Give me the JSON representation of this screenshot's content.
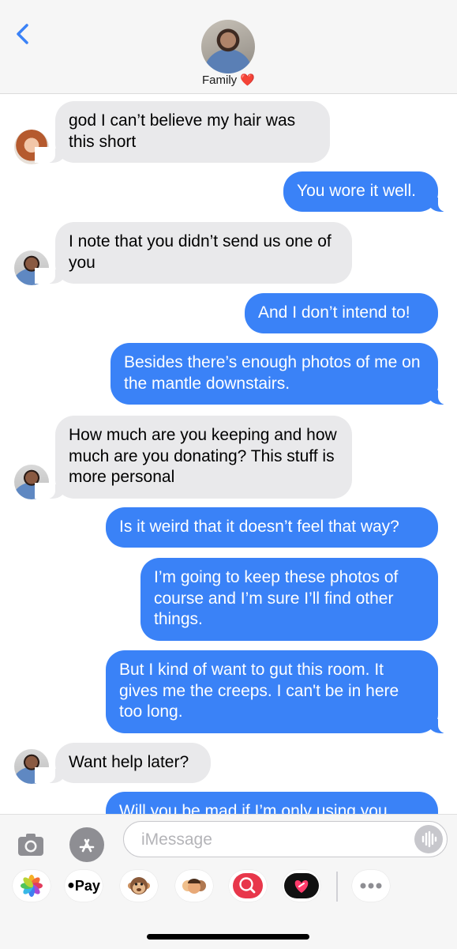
{
  "header": {
    "contact_name": "Family",
    "heart": "❤️"
  },
  "messages": [
    {
      "id": "m1",
      "direction": "in",
      "sender_avatar": "woman",
      "text": "god I can’t believe my hair was this short"
    },
    {
      "id": "m2",
      "direction": "out",
      "text": "You wore it well."
    },
    {
      "id": "m3",
      "direction": "in",
      "sender_avatar": "man",
      "text": "I note that you didn’t send us one of you"
    },
    {
      "id": "m4",
      "direction": "out",
      "text": "And I don’t intend to!"
    },
    {
      "id": "m5",
      "direction": "out",
      "text": "Besides there’s enough photos of me on the mantle downstairs."
    },
    {
      "id": "m6",
      "direction": "in",
      "sender_avatar": "man",
      "text": "How much are you keeping and how much are you donating? This stuff is more personal"
    },
    {
      "id": "m7",
      "direction": "out",
      "text": "Is it weird that it doesn’t feel that way?"
    },
    {
      "id": "m8",
      "direction": "out",
      "text": "I’m going to keep these photos of course and I’m sure I’ll find other things."
    },
    {
      "id": "m9",
      "direction": "out",
      "text": "But I kind of want to gut this room. It gives me the creeps. I can't be in here too long."
    },
    {
      "id": "m10",
      "direction": "in",
      "sender_avatar": "man",
      "text": "Want help later?"
    },
    {
      "id": "m11",
      "direction": "out",
      "text": "Will you be mad if I’m only using you"
    }
  ],
  "composer": {
    "placeholder": "iMessage"
  },
  "app_drawer": [
    {
      "name": "photos-app",
      "label": ""
    },
    {
      "name": "apple-pay-app",
      "label": "Pay"
    },
    {
      "name": "animoji-app",
      "label": ""
    },
    {
      "name": "memoji-stickers-app",
      "label": ""
    },
    {
      "name": "image-search-app",
      "label": ""
    },
    {
      "name": "digital-touch-app",
      "label": ""
    },
    {
      "name": "more-apps",
      "label": ""
    }
  ],
  "colors": {
    "outgoing_bubble": "#3a82f7",
    "incoming_bubble": "#e9e9eb",
    "accent": "#3a82f7"
  }
}
